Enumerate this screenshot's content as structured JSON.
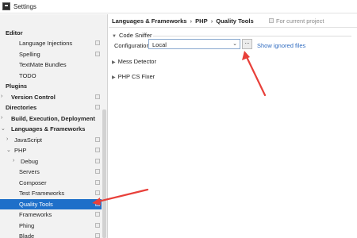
{
  "window": {
    "title": "Settings"
  },
  "sidebar": {
    "items": [
      {
        "label": "Editor",
        "bold": true,
        "project": false,
        "arrow": ""
      },
      {
        "label": "Language Injections",
        "bold": false,
        "project": true,
        "arrow": ""
      },
      {
        "label": "Spelling",
        "bold": false,
        "project": true,
        "arrow": ""
      },
      {
        "label": "TextMate Bundles",
        "bold": false,
        "project": false,
        "arrow": ""
      },
      {
        "label": "TODO",
        "bold": false,
        "project": false,
        "arrow": ""
      },
      {
        "label": "Plugins",
        "bold": true,
        "project": false,
        "arrow": ""
      },
      {
        "label": "Version Control",
        "bold": true,
        "project": true,
        "arrow": "›"
      },
      {
        "label": "Directories",
        "bold": true,
        "project": true,
        "arrow": ""
      },
      {
        "label": "Build, Execution, Deployment",
        "bold": true,
        "project": false,
        "arrow": "›"
      },
      {
        "label": "Languages & Frameworks",
        "bold": true,
        "project": false,
        "arrow": "⌄"
      },
      {
        "label": "JavaScript",
        "bold": false,
        "project": true,
        "arrow": "›"
      },
      {
        "label": "PHP",
        "bold": false,
        "project": true,
        "arrow": "⌄"
      },
      {
        "label": "Debug",
        "bold": false,
        "project": true,
        "arrow": "›"
      },
      {
        "label": "Servers",
        "bold": false,
        "project": true,
        "arrow": ""
      },
      {
        "label": "Composer",
        "bold": false,
        "project": true,
        "arrow": ""
      },
      {
        "label": "Test Frameworks",
        "bold": false,
        "project": true,
        "arrow": ""
      },
      {
        "label": "Quality Tools",
        "bold": false,
        "project": true,
        "arrow": "",
        "selected": true
      },
      {
        "label": "Frameworks",
        "bold": false,
        "project": true,
        "arrow": ""
      },
      {
        "label": "Phing",
        "bold": false,
        "project": true,
        "arrow": ""
      },
      {
        "label": "Blade",
        "bold": false,
        "project": true,
        "arrow": ""
      }
    ]
  },
  "header": {
    "breadcrumb": [
      "Languages & Frameworks",
      "PHP",
      "Quality Tools"
    ],
    "separator": "›",
    "scope_label": "For current project"
  },
  "code_sniffer": {
    "title": "Code Sniffer",
    "config_label": "Configuration:",
    "config_value": "Local",
    "browse_label": "...",
    "link_label": "Show ignored files"
  },
  "sections": [
    {
      "title": "Mess Detector"
    },
    {
      "title": "PHP CS Fixer"
    }
  ],
  "colors": {
    "selection": "#1e6fc9",
    "link": "#2f6bc0",
    "annotation_arrow": "#e8403a"
  },
  "icons": {
    "app": "intellij-app-icon",
    "project_scope": "project-scope-icon",
    "expand": "chevron-down-icon",
    "collapse": "chevron-right-icon"
  }
}
